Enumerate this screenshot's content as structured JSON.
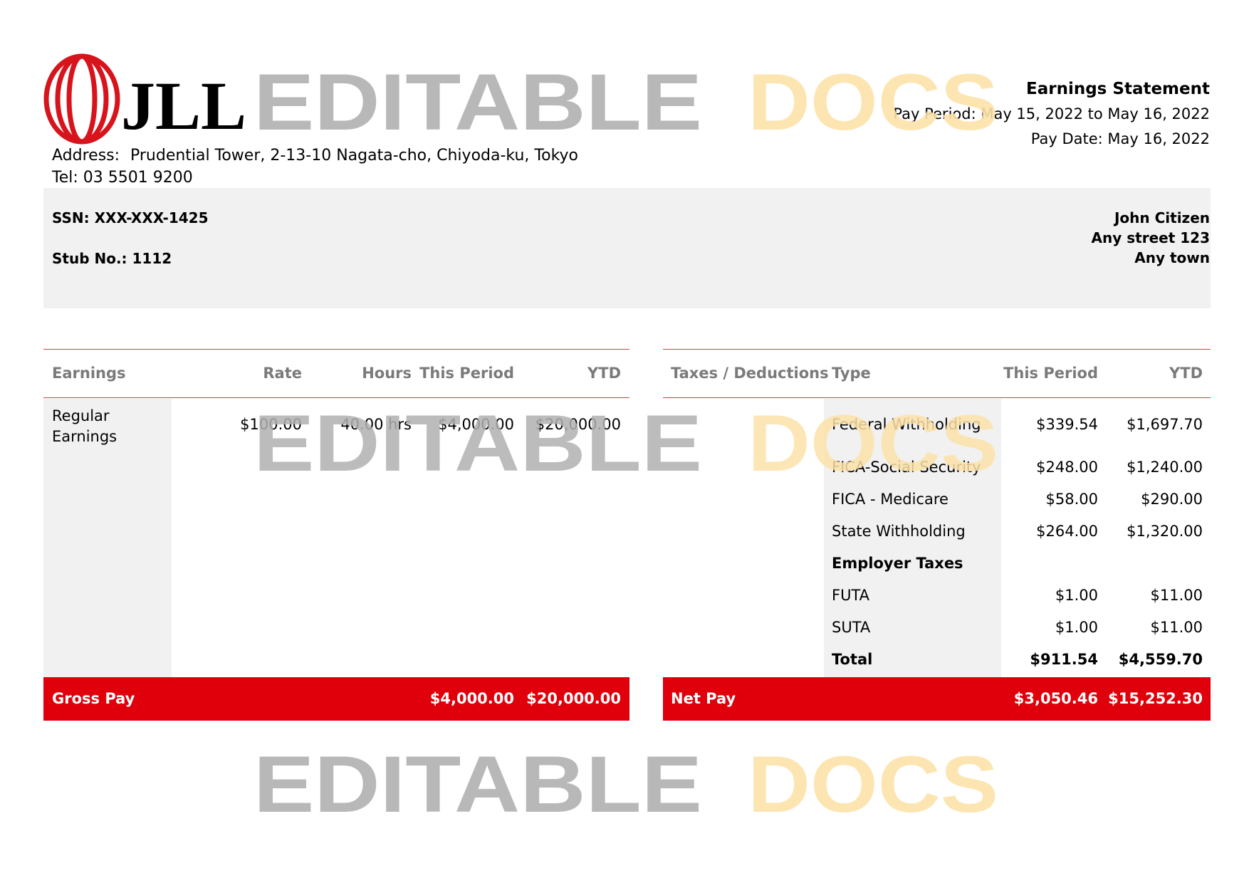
{
  "company": {
    "logo_text": "JLL",
    "address_label": "Address:",
    "address_value": "Prudential Tower, 2-13-10 Nagata-cho, Chiyoda-ku, Tokyo",
    "tel": "Tel: 03 5501 9200"
  },
  "statement": {
    "title": "Earnings Statement",
    "pay_period_label": "Pay Period:",
    "pay_period_value": "May 15, 2022 to May 16, 2022",
    "pay_date": "Pay Date: May 16, 2022"
  },
  "employee": {
    "ssn": "SSN: XXX-XXX-1425",
    "stub": "Stub No.: 1112",
    "name": "John Citizen",
    "street": "Any street 123",
    "town": "Any town"
  },
  "earnings": {
    "headers": [
      "Earnings",
      "Rate",
      "Hours",
      "This Period",
      "YTD"
    ],
    "rows": [
      {
        "label_line1": "Regular",
        "label_line2": "Earnings",
        "rate": "$100.00",
        "hours": "40.00 hrs",
        "this_period": "$4,000.00",
        "ytd": "$20,000.00"
      }
    ],
    "gross_label": "Gross Pay",
    "gross_this_period": "$4,000.00",
    "gross_ytd": "$20,000.00"
  },
  "deductions": {
    "headers": [
      "Taxes / Deductions",
      "Type",
      "This Period",
      "YTD"
    ],
    "rows": [
      {
        "type": "Federal Withholding",
        "this_period": "$339.54",
        "ytd": "$1,697.70"
      },
      {
        "type": "FICA-Social Security",
        "this_period": "$248.00",
        "ytd": "$1,240.00"
      },
      {
        "type": "FICA - Medicare",
        "this_period": "$58.00",
        "ytd": "$290.00"
      },
      {
        "type": "State Withholding",
        "this_period": "$264.00",
        "ytd": "$1,320.00"
      },
      {
        "type": "Employer Taxes",
        "this_period": "",
        "ytd": ""
      },
      {
        "type": "FUTA",
        "this_period": "$1.00",
        "ytd": "$11.00"
      },
      {
        "type": "SUTA",
        "this_period": "$1.00",
        "ytd": "$11.00"
      },
      {
        "type": "Total",
        "this_period": "$911.54",
        "ytd": "$4,559.70"
      }
    ],
    "net_label": "Net Pay",
    "net_this_period": "$3,050.46",
    "net_ytd": "$15,252.30"
  },
  "watermark": {
    "word1": "EDITABLE",
    "word2": "DOCS"
  },
  "colors": {
    "accent_red": "#e0000b",
    "rule_red": "#c34646",
    "band_gray": "#f1f1f1",
    "header_gray": "#7a7a7a",
    "watermark_gray": "#b0b0b0",
    "watermark_orange": "#fde2a9"
  }
}
